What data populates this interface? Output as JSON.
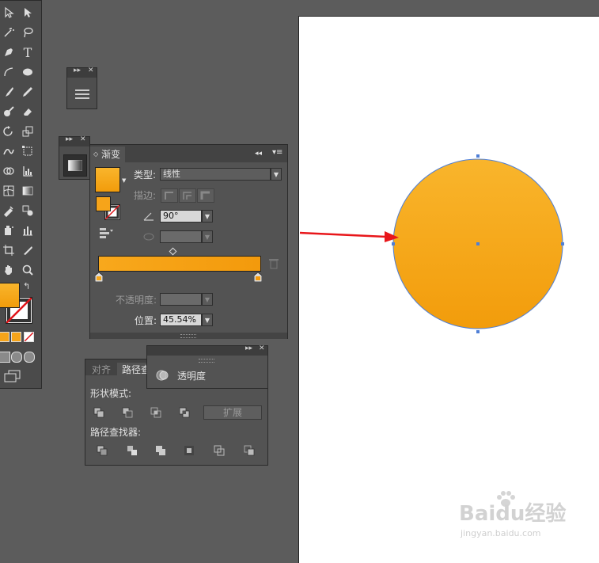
{
  "gradient_panel": {
    "tab": "渐变",
    "type_label": "类型:",
    "type_value": "线性",
    "stroke_label": "描边:",
    "angle_value": "90°",
    "opacity_label": "不透明度:",
    "location_label": "位置:",
    "location_value": "45.54%",
    "colors": {
      "start": "#f8a81c",
      "end": "#f39a0c"
    }
  },
  "transparency_panel": {
    "title": "透明度"
  },
  "pathfinder_panel": {
    "tabs": [
      "对齐",
      "路径查"
    ],
    "shape_modes_label": "形状模式:",
    "expand_button": "扩展",
    "pathfinders_label": "路径查找器:"
  },
  "canvas": {
    "artboard_color": "#ffffff",
    "circle": {
      "fill_top": "#f9b52c",
      "fill_bottom": "#f29c0b",
      "path_color": "#4f7fd6"
    },
    "arrow_color": "#e8161a"
  },
  "watermark": {
    "brand": "Baidu经验",
    "url": "jingyan.baidu.com"
  },
  "icons": [
    "selection-icon",
    "direct-selection-icon",
    "magic-wand-icon",
    "lasso-icon",
    "pen-icon",
    "type-icon",
    "line-icon",
    "ellipse-icon",
    "brush-icon",
    "pencil-icon",
    "blob-brush-icon",
    "eraser-icon",
    "rotate-icon",
    "scale-icon",
    "warp-icon",
    "free-transform-icon",
    "shape-builder-icon",
    "graph-icon",
    "mesh-icon",
    "gradient-icon",
    "eyedropper-icon",
    "blend-icon",
    "symbol-sprayer-icon",
    "column-graph-icon",
    "artboard-icon",
    "slice-icon",
    "hand-icon",
    "zoom-icon"
  ]
}
